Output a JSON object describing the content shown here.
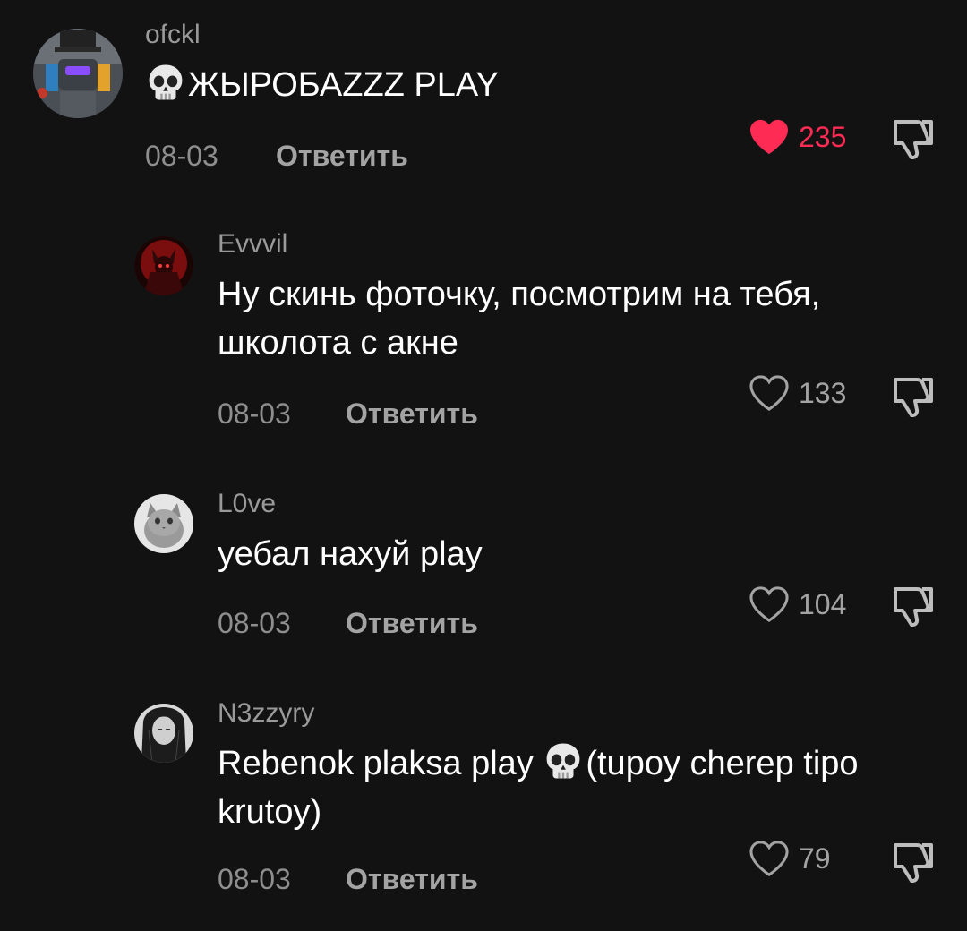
{
  "comments": [
    {
      "username": "ofckl",
      "text_prefix_icon": "skull-emoji",
      "text": "ЖЫРОБАZZZ PLAY",
      "date": "08-03",
      "reply_label": "Ответить",
      "likes": "235",
      "liked": true,
      "avatar_icon": "robot-avatar"
    },
    {
      "username": "Evvvil",
      "text_line1": "Ну скинь фоточку, посмотрим на тебя,",
      "text_line2": "школота с акне",
      "date": "08-03",
      "reply_label": "Ответить",
      "likes": "133",
      "liked": false,
      "avatar_icon": "red-demon-avatar"
    },
    {
      "username": "L0ve",
      "text": "уебал нахуй play",
      "date": "08-03",
      "reply_label": "Ответить",
      "likes": "104",
      "liked": false,
      "avatar_icon": "cat-avatar"
    },
    {
      "username": "N3zzyry",
      "text_line1_a": "Rebenok plaksa play ",
      "text_line1_icon": "skull-emoji",
      "text_line1_b": "(tupoy cherep tipo",
      "text_line2": "krutoy)",
      "date": "08-03",
      "reply_label": "Ответить",
      "likes": "79",
      "liked": false,
      "avatar_icon": "anime-girl-avatar"
    }
  ],
  "colors": {
    "background": "#121212",
    "like_active": "#fe2c55",
    "muted_text": "#a3a3a3",
    "username": "#9a9a9a"
  }
}
